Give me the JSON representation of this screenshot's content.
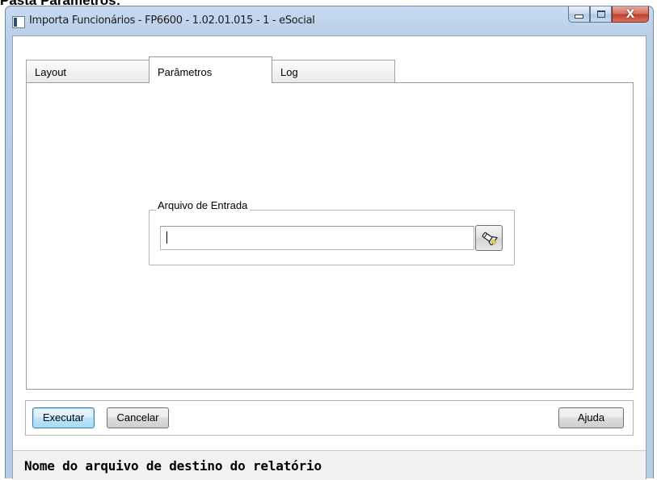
{
  "caption": "Pasta Parâmetros:",
  "window": {
    "title": "Importa Funcionários - FP6600 - 1.02.01.015 - 1 - eSocial",
    "icon": "app-window-icon",
    "controls": {
      "minimize_icon": "minimize-icon",
      "maximize_icon": "maximize-icon",
      "close_glyph": "X"
    }
  },
  "tabs": [
    {
      "label": "Layout",
      "active": false
    },
    {
      "label": "Parâmetros",
      "active": true
    },
    {
      "label": "Log",
      "active": false
    }
  ],
  "parametros": {
    "groupbox_label": "Arquivo de Entrada",
    "file_input_value": "",
    "browse_icon": "flashlight-search-icon"
  },
  "actions": {
    "execute_label": "Executar",
    "cancel_label": "Cancelar",
    "help_label": "Ajuda"
  },
  "status_bar": {
    "text": "Nome do arquivo de destino do relatório"
  },
  "colors": {
    "frame": "#b9cfe6",
    "default_button": "#3c7fb1",
    "close_button": "#c9483a"
  }
}
